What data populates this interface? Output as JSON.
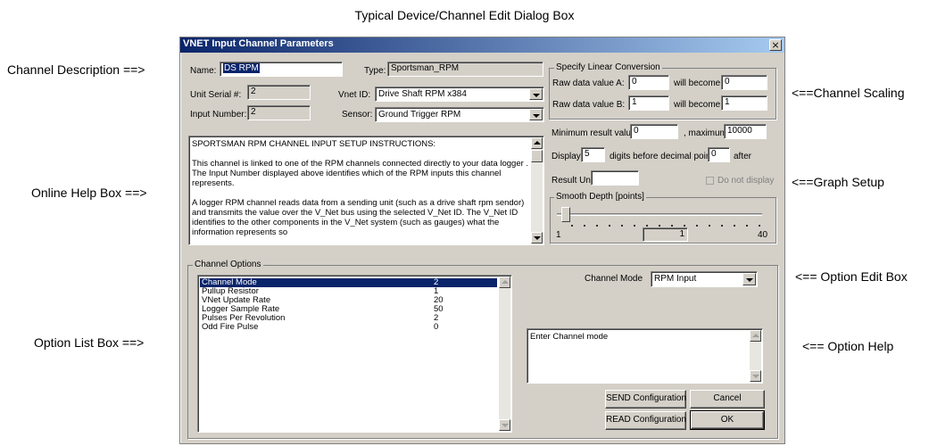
{
  "figure": {
    "title": "Typical Device/Channel Edit Dialog Box",
    "callouts": {
      "channel_description": "Channel Description ==>",
      "online_help_box": "Online Help Box ==>",
      "option_list_box": "Option List Box ==>",
      "channel_scaling": "<==Channel Scaling",
      "graph_setup": "<==Graph Setup",
      "option_edit_box": "<== Option Edit Box",
      "option_help": "<== Option Help"
    }
  },
  "dialog": {
    "title": "VNET Input Channel Parameters",
    "close_glyph": "×",
    "name_label": "Name:",
    "name_value": "DS RPM",
    "type_label": "Type:",
    "type_value": "Sportsman_RPM",
    "serial_label": "Unit Serial #:",
    "serial_value": "2",
    "vnet_id_label": "Vnet ID:",
    "vnet_id_value": "Drive Shaft RPM  x384",
    "input_number_label": "Input Number:",
    "input_number_value": "2",
    "sensor_label": "Sensor:",
    "sensor_value": "Ground Trigger RPM",
    "help_text": "SPORTSMAN RPM CHANNEL INPUT SETUP INSTRUCTIONS:\n\nThis channel is linked to one of the RPM channels connected directly to your data logger .  The Input Number displayed above identifies which of the RPM inputs this channel represents.\n\nA logger  RPM channel reads data from a sending unit (such as a drive shaft rpm sendor) and  transmits the value over the V_Net bus using the selected V_Net ID.  The V_Net ID identifies to the other components in the V_Net system (such as gauges) what the information represents so"
  },
  "scaling": {
    "group_title": "Specify Linear Conversion",
    "raw_a_label": "Raw data value A:",
    "raw_a_value": "0",
    "raw_a_becomes_label": "will become",
    "raw_a_becomes_value": "0",
    "raw_b_label": "Raw data value B:",
    "raw_b_value": "1",
    "raw_b_becomes_label": "will become",
    "raw_b_becomes_value": "1"
  },
  "graph": {
    "min_label": "Minimum result value:",
    "min_value": "0",
    "max_label": ", maximum:",
    "max_value": "10000",
    "display_label": "Display:",
    "display_digits": "5",
    "digits_before_label": "digits before decimal point,",
    "digits_after": "0",
    "after_label": "after",
    "result_unit_label": "Result Unit:",
    "result_unit_value": "",
    "do_not_display_label": "Do not display",
    "do_not_display_checked": false,
    "smooth_title": "Smooth Depth [points]",
    "smooth_min": "1",
    "smooth_max": "40",
    "smooth_value": "1"
  },
  "options": {
    "group_title": "Channel Options",
    "list": [
      {
        "name": "Channel Mode",
        "value": "2",
        "selected": true
      },
      {
        "name": "Pullup Resistor",
        "value": "1",
        "selected": false
      },
      {
        "name": "VNet Update Rate",
        "value": "20",
        "selected": false
      },
      {
        "name": "Logger Sample Rate",
        "value": "50",
        "selected": false
      },
      {
        "name": "Pulses Per Revolution",
        "value": "2",
        "selected": false
      },
      {
        "name": "Odd Fire Pulse",
        "value": "0",
        "selected": false
      }
    ],
    "edit_label": "Channel Mode",
    "edit_value": "RPM Input",
    "help_text": "Enter Channel mode"
  },
  "buttons": {
    "send": "SEND Configuration",
    "cancel": "Cancel",
    "read": "READ Configuration",
    "ok": "OK"
  }
}
